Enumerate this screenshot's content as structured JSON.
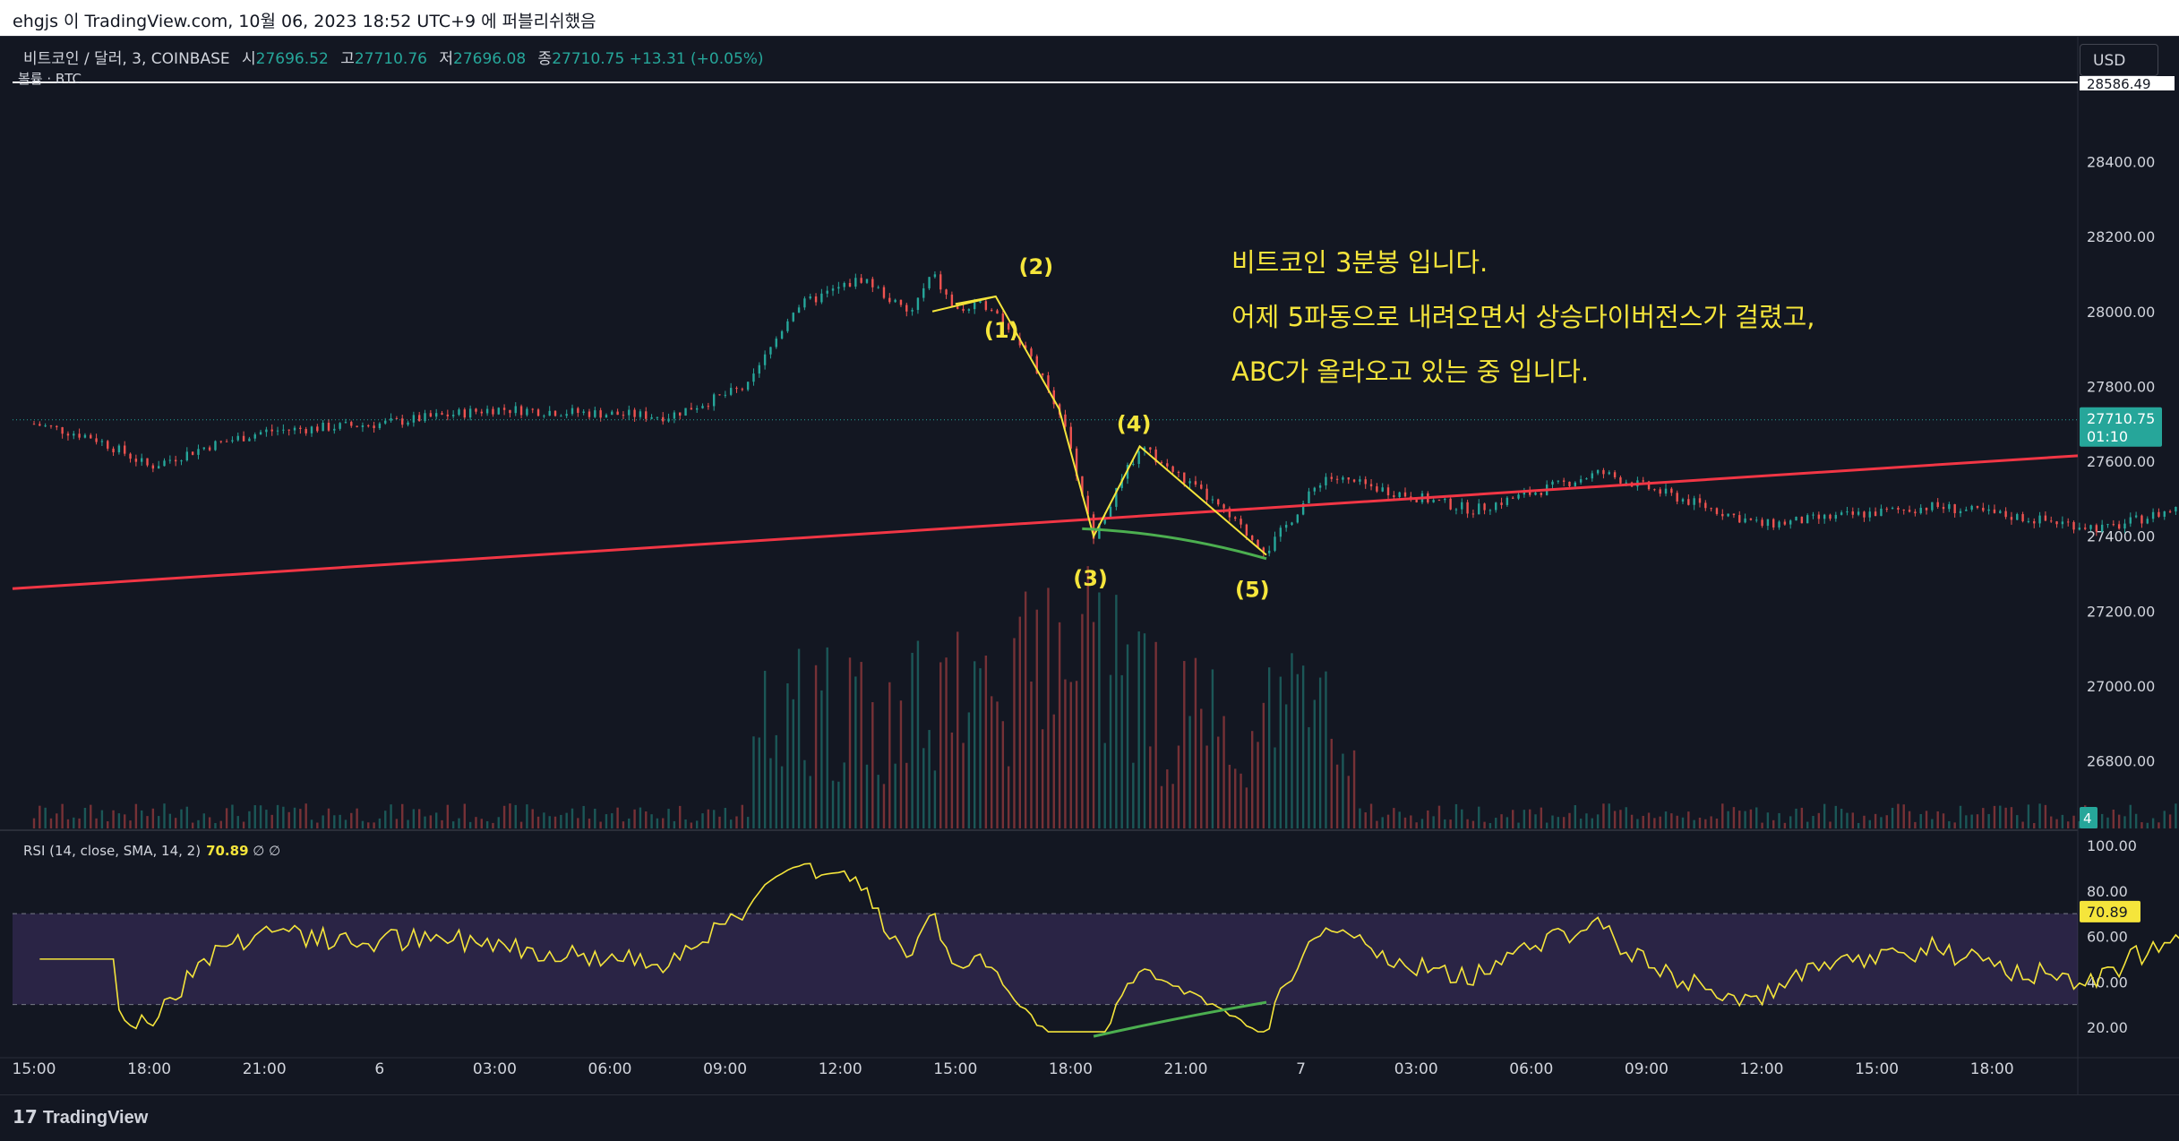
{
  "header": {
    "text": "ehgjs 이 TradingView.com, 10월 06, 2023 18:52 UTC+9 에 퍼블리쉬했음"
  },
  "legend": {
    "symbol": "비트코인 / 달러, 3, COINBASE",
    "open_label": "시",
    "open": "27696.52",
    "high_label": "고",
    "high": "27710.76",
    "low_label": "저",
    "low": "27696.08",
    "close_label": "종",
    "close": "27710.75",
    "change": "+13.31 (+0.05%)",
    "volume_label": "볼륨 · BTC"
  },
  "currency_button": "USD",
  "rsi_legend": {
    "text": "RSI (14, close, SMA, 14, 2)",
    "value": "70.89",
    "extra": "∅  ∅"
  },
  "annotation": {
    "line1": "비트코인 3분봉 입니다.",
    "line2": "어제 5파동으로 내려오면서 상승다이버전스가 걸렸고,",
    "line3": "ABC가 올라오고 있는 중 입니다."
  },
  "price_tag": {
    "value": "27710.75",
    "countdown": "01:10"
  },
  "volume_tag": "4",
  "rsi_tag": "70.89",
  "top_price_label": "28586.49",
  "brand": "TradingView",
  "colors": {
    "up": "#26a69a",
    "down": "#ef5350",
    "support": "#f23645",
    "rsi": "#f5e53b",
    "rsi_band": "#7e57c2",
    "divergence": "#4caf50",
    "wave": "#f5e53b"
  },
  "chart_data": {
    "type": "candlestick",
    "symbol": "BTC/USD",
    "interval": "3m",
    "price_axis": {
      "ticks": [
        26800,
        27000,
        27200,
        27400,
        27600,
        27800,
        28000,
        28200,
        28400
      ],
      "labels": [
        "26800.00",
        "27000.00",
        "27200.00",
        "27400.00",
        "27600.00",
        "27800.00",
        "28000.00",
        "28200.00",
        "28400.00"
      ],
      "range": [
        26620,
        28590
      ]
    },
    "time_axis": {
      "ticks": [
        "15:00",
        "18:00",
        "21:00",
        "6",
        "03:00",
        "06:00",
        "09:00",
        "12:00",
        "15:00",
        "18:00",
        "21:00",
        "7",
        "03:00",
        "06:00",
        "09:00",
        "12:00",
        "15:00",
        "18:00"
      ]
    },
    "price_path": [
      {
        "t": 0,
        "p": 27700
      },
      {
        "t": 0.5,
        "p": 27665
      },
      {
        "t": 0.8,
        "p": 27620
      },
      {
        "t": 1.0,
        "p": 27585
      },
      {
        "t": 1.5,
        "p": 27640
      },
      {
        "t": 2.0,
        "p": 27680
      },
      {
        "t": 3.0,
        "p": 27700
      },
      {
        "t": 4.0,
        "p": 27740
      },
      {
        "t": 5.5,
        "p": 27720
      },
      {
        "t": 6.2,
        "p": 27800
      },
      {
        "t": 6.6,
        "p": 28010
      },
      {
        "t": 7.2,
        "p": 28090
      },
      {
        "t": 7.6,
        "p": 27990
      },
      {
        "t": 7.8,
        "p": 28100
      },
      {
        "t": 8.0,
        "p": 28000
      },
      {
        "t": 8.3,
        "p": 28020
      },
      {
        "t": 8.6,
        "p": 27900
      },
      {
        "t": 8.9,
        "p": 27740
      },
      {
        "t": 9.2,
        "p": 27400
      },
      {
        "t": 9.6,
        "p": 27640
      },
      {
        "t": 10.2,
        "p": 27500
      },
      {
        "t": 10.7,
        "p": 27360
      },
      {
        "t": 11.2,
        "p": 27560
      },
      {
        "t": 12.5,
        "p": 27470
      },
      {
        "t": 13.6,
        "p": 27570
      },
      {
        "t": 15.0,
        "p": 27430
      },
      {
        "t": 16.5,
        "p": 27480
      },
      {
        "t": 18.0,
        "p": 27420
      },
      {
        "t": 20.0,
        "p": 27600
      },
      {
        "t": 21.5,
        "p": 27580
      },
      {
        "t": 23.0,
        "p": 27540
      },
      {
        "t": 24.5,
        "p": 27490
      },
      {
        "t": 25.2,
        "p": 27520
      },
      {
        "t": 25.9,
        "p": 27670
      },
      {
        "t": 26.6,
        "p": 27620
      },
      {
        "t": 27.2,
        "p": 27680
      },
      {
        "t": 27.5,
        "p": 27710.75
      }
    ],
    "support_line": {
      "start": 27260,
      "end": 27615
    },
    "wave_labels": [
      "(1)",
      "(2)",
      "(3)",
      "(4)",
      "(5)"
    ],
    "rsi": {
      "axis_labels": [
        "20.00",
        "40.00",
        "60.00",
        "80.00",
        "100.00"
      ],
      "upper_band": 70,
      "lower_band": 30,
      "last": 70.89
    }
  }
}
